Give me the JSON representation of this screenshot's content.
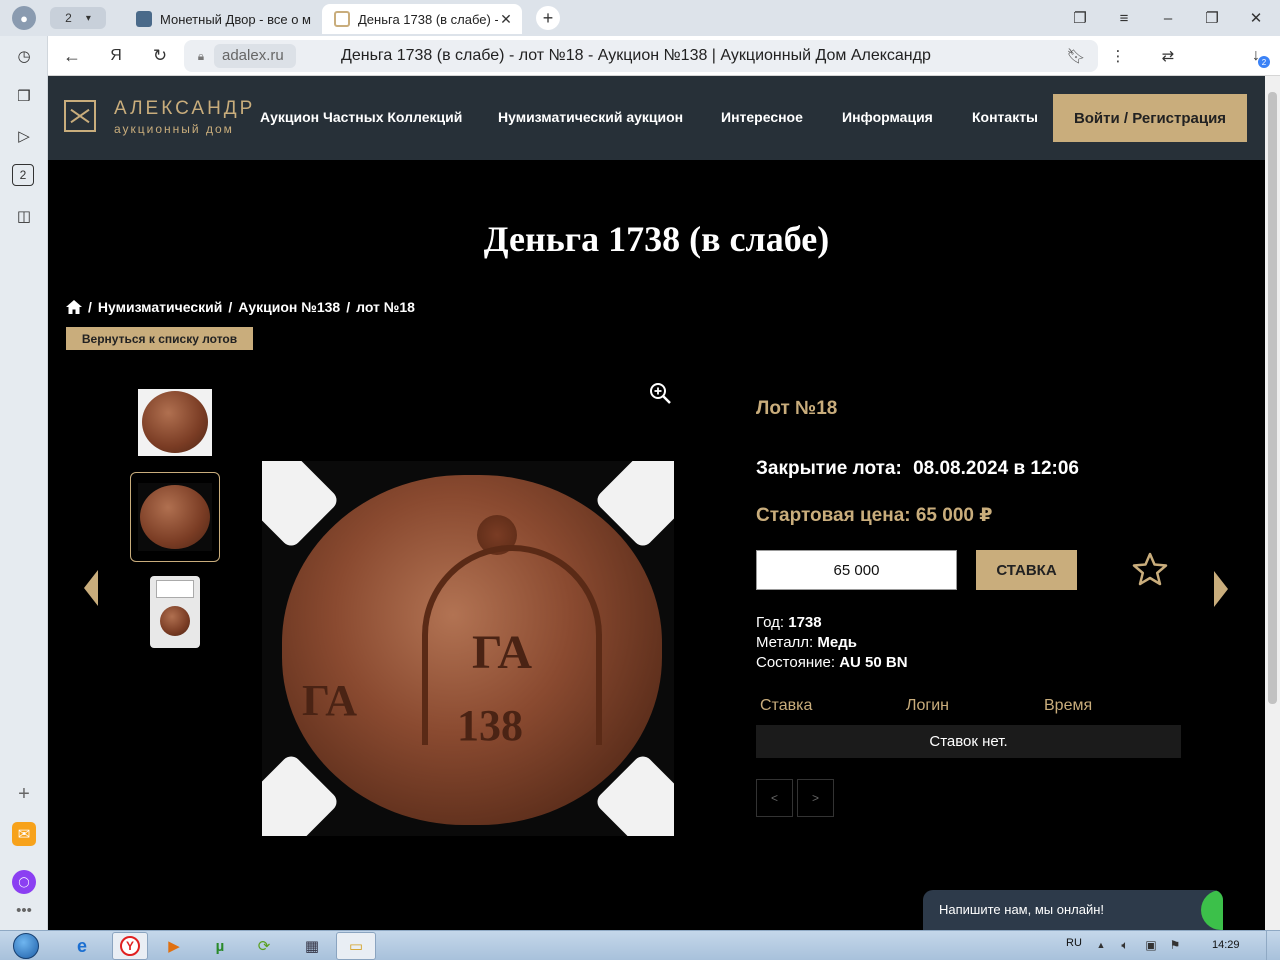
{
  "browser": {
    "tab_count": "2",
    "tabs": [
      {
        "title": "Монетный Двор - все о м"
      },
      {
        "title": "Деньга 1738 (в слабе) -"
      }
    ],
    "domain": "adalex.ru",
    "page_title": "Деньга 1738 (в слабе) - лот №18 - Аукцион №138 | Аукционный Дом Александр",
    "sidebar_badge": "2",
    "download_badge": "2"
  },
  "site": {
    "logo_name": "АЛЕКСАНДР",
    "logo_sub": "аукционный дом",
    "nav": [
      "Аукцион Частных Коллекций",
      "Нумизматический аукцион",
      "Интересное",
      "Информация",
      "Контакты"
    ],
    "login": "Войти / Регистрация",
    "accent": "#c9ad7c"
  },
  "page": {
    "title": "Деньга 1738 (в слабе)",
    "breadcrumbs": [
      "Нумизматический",
      "Аукцион №138",
      "лот №18"
    ],
    "back": "Вернуться к списку лотов"
  },
  "coin_image": {
    "inscription_top": "ГА",
    "inscription_year": "138",
    "inscription_left": "ГА"
  },
  "lot": {
    "number": "Лот №18",
    "close_label": "Закрытие лота:",
    "close_value": "08.08.2024 в 12:06",
    "start_price": "Стартовая цена: 65 000 ₽",
    "bid_value": "65 000",
    "bid_button": "СТАВКА",
    "props": [
      {
        "label": "Год:",
        "value": "1738"
      },
      {
        "label": "Металл:",
        "value": "Медь"
      },
      {
        "label": "Состояние:",
        "value": "AU 50 BN"
      }
    ],
    "table_headers": [
      "Ставка",
      "Логин",
      "Время"
    ],
    "no_bids": "Ставок нет.",
    "prev": "<",
    "next": ">"
  },
  "chat": {
    "text": "Напишите нам, мы онлайн!"
  },
  "taskbar": {
    "lang": "RU",
    "time": "14:29"
  }
}
